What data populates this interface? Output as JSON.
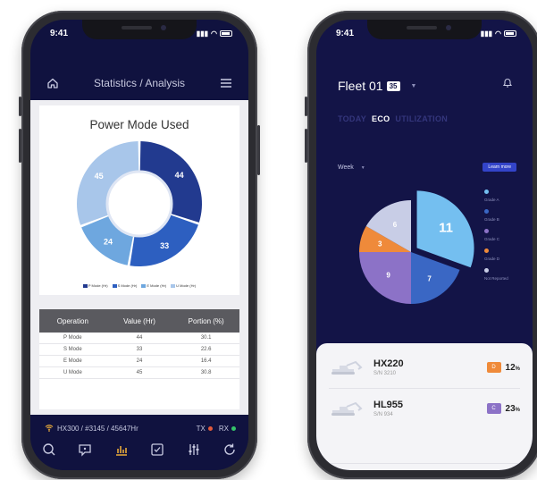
{
  "left_phone": {
    "status_time": "9:41",
    "header_title": "Statistics / Analysis",
    "card_title": "Power Mode Used",
    "donut_values": [
      44,
      33,
      24,
      45
    ],
    "donut_colors": [
      "#223a8f",
      "#2d5fc0",
      "#6ea7df",
      "#a8c6ea"
    ],
    "legend": [
      {
        "label": "P Mode (Hr)",
        "color": "#223a8f"
      },
      {
        "label": "S Mode (Hr)",
        "color": "#2d5fc0"
      },
      {
        "label": "E Mode (Hr)",
        "color": "#6ea7df"
      },
      {
        "label": "U Mode (Hr)",
        "color": "#a8c6ea"
      }
    ],
    "table": {
      "headers": [
        "Operation",
        "Value (Hr)",
        "Portion (%)"
      ],
      "rows": [
        [
          "P Mode",
          "44",
          "30.1"
        ],
        [
          "S Mode",
          "33",
          "22.6"
        ],
        [
          "E Mode",
          "24",
          "16.4"
        ],
        [
          "U Mode",
          "45",
          "30.8"
        ]
      ]
    },
    "device_line": "HX300 / #3145 / 45647Hr",
    "tx_label": "TX",
    "rx_label": "RX",
    "tx_color": "#e15a3c",
    "rx_color": "#35c46a"
  },
  "right_phone": {
    "status_time": "9:41",
    "fleet_name": "Fleet 01",
    "fleet_count": "35",
    "tabs": [
      "TODAY",
      "ECO",
      "UTILIZATION"
    ],
    "active_tab": "ECO",
    "period": "Week",
    "learn_more": "Learn more",
    "pie": [
      {
        "value": 11,
        "color": "#74bff0"
      },
      {
        "value": 7,
        "color": "#3a67c4"
      },
      {
        "value": 9,
        "color": "#8c72c7"
      },
      {
        "value": 3,
        "color": "#ef8a3a"
      },
      {
        "value": 6,
        "color": "#c8cde6"
      }
    ],
    "legend": [
      {
        "label": "Grade A",
        "color": "#74bff0"
      },
      {
        "label": "Grade B",
        "color": "#3a67c4"
      },
      {
        "label": "Grade C",
        "color": "#8c72c7"
      },
      {
        "label": "Grade D",
        "color": "#ef8a3a"
      },
      {
        "label": "Not Reported",
        "color": "#c8cde6"
      }
    ],
    "machines": [
      {
        "name": "HX220",
        "sn": "S/N 3210",
        "grade": "D",
        "grade_color": "#ef8a3a",
        "pct": "12",
        "unit": "%"
      },
      {
        "name": "HL955",
        "sn": "S/N 934",
        "grade": "C",
        "grade_color": "#8c72c7",
        "pct": "23",
        "unit": "%"
      }
    ]
  }
}
